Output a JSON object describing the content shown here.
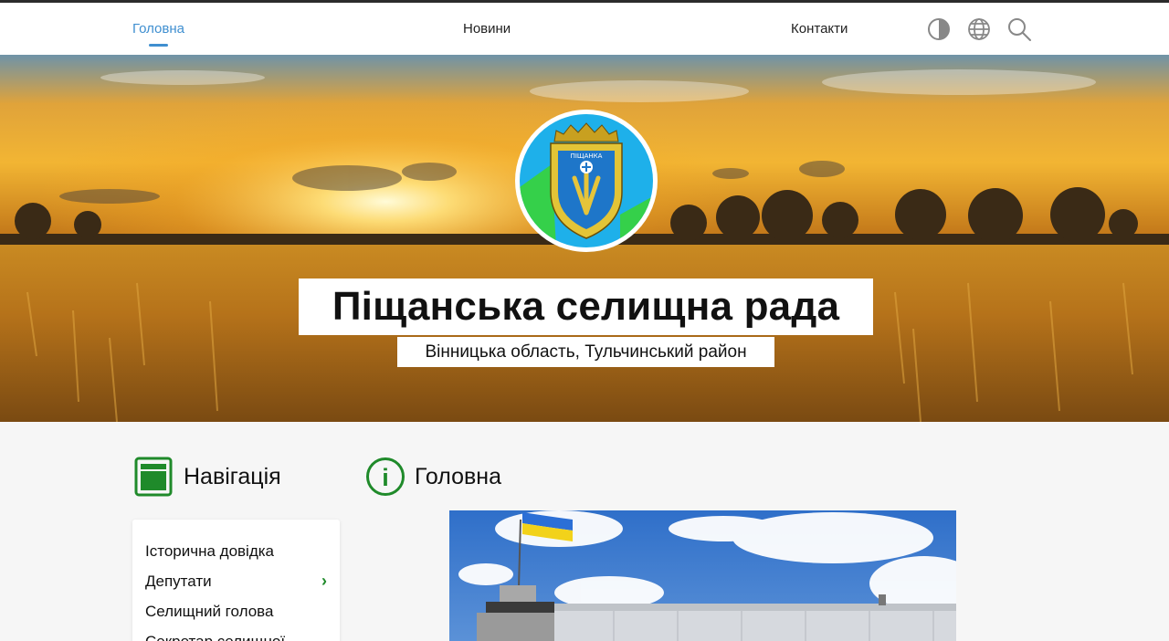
{
  "nav": {
    "home": "Головна",
    "news": "Новини",
    "contacts": "Контакти"
  },
  "icons": {
    "contrast": "contrast-icon",
    "language": "globe-icon",
    "search": "search-icon"
  },
  "hero": {
    "title": "Піщанська селищна рада",
    "subtitle": "Вінницька область, Тульчинський район",
    "emblem_text": "ПІЩАНКА"
  },
  "navigation": {
    "heading": "Навігація",
    "items": [
      {
        "label": "Історична довідка"
      },
      {
        "label": "Депутати",
        "chevron": "›"
      },
      {
        "label": "Селищний голова"
      },
      {
        "label": "Секретар селищної"
      }
    ]
  },
  "main": {
    "heading": "Головна",
    "info_glyph": "i"
  },
  "colors": {
    "accent_blue": "#3f8fd0",
    "accent_green": "#1f8a2a"
  }
}
